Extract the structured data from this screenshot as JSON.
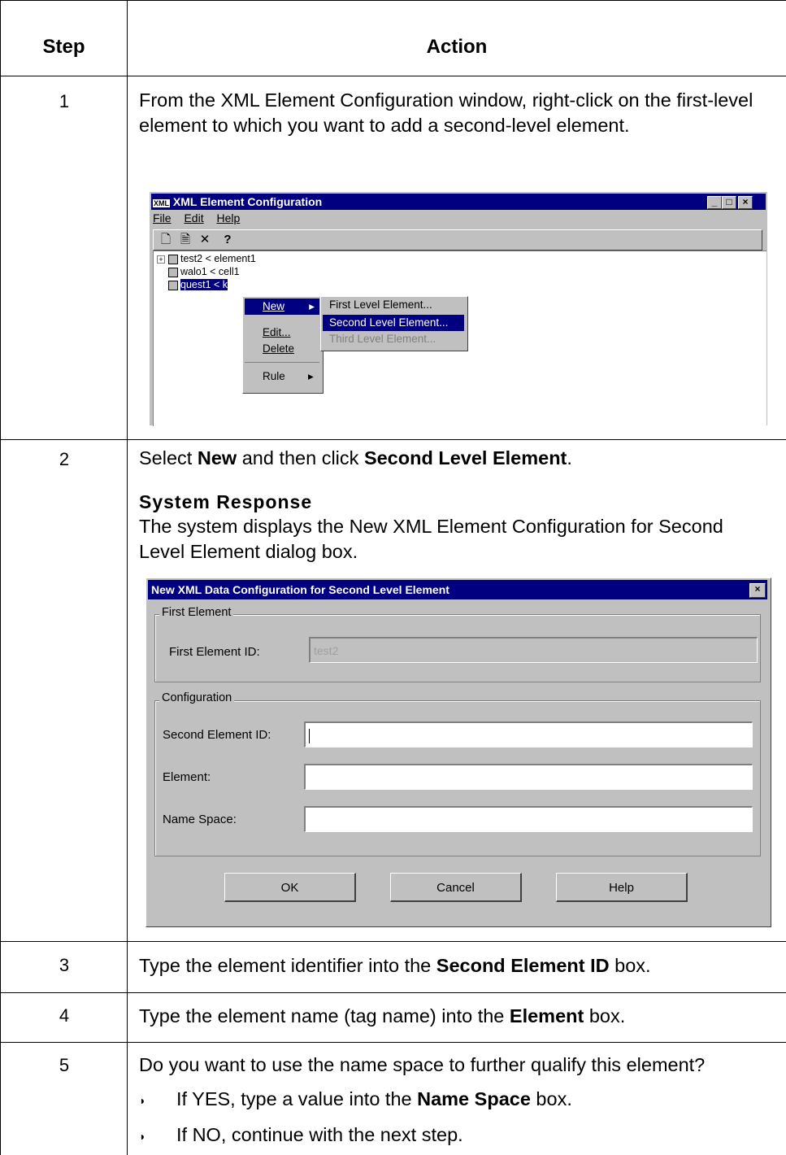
{
  "table": {
    "header_step": "Step",
    "header_action": "Action"
  },
  "steps": [
    {
      "num": "1",
      "text": "From the XML Element Configuration window, right-click on the first-level element to which you want to add a second-level element."
    },
    {
      "num": "2",
      "pre": "Select ",
      "b1": "New",
      "mid": " and then click ",
      "b2": "Second Level Element",
      "post": ".",
      "response_title": "System Response",
      "response_text": "The system displays the New XML Element Configuration for Second Level Element dialog box."
    },
    {
      "num": "3",
      "pre": "Type the element identifier into the ",
      "b1": "Second Element ID",
      "post": " box."
    },
    {
      "num": "4",
      "pre": "Type the element name (tag name) into the ",
      "b1": "Element",
      "post": " box."
    },
    {
      "num": "5",
      "text": "Do you want to use the name space to further qualify this element?",
      "bullet1_pre": "If YES, type a value into the ",
      "bullet1_b": "Name Space",
      "bullet1_post": " box.",
      "bullet2": "If NO, continue with the next step.",
      "bullet_mark": "◗"
    }
  ],
  "xml_window": {
    "title": "XML Element Configuration",
    "app_icon": "XML",
    "menu": [
      "File",
      "Edit",
      "Help"
    ],
    "toolbar_icons": [
      "new-icon",
      "properties-icon",
      "delete-icon",
      "help-icon"
    ],
    "tree": [
      "test2 < element1",
      "walo1 < cell1",
      "quest1 < k"
    ],
    "context_menu": [
      "New",
      "Edit...",
      "Delete",
      "Rule"
    ],
    "submenu": [
      "First Level Element...",
      "Second Level Element...",
      "Third Level Element..."
    ],
    "win_controls": [
      "_",
      "□",
      "×"
    ]
  },
  "dialog": {
    "title": "New XML Data Configuration for Second Level Element",
    "close": "×",
    "group1": "First Element",
    "first_id_label": "First Element ID:",
    "first_id_value": "test2",
    "group2": "Configuration",
    "second_id_label": "Second Element ID:",
    "element_label": "Element:",
    "namespace_label": "Name Space:",
    "ok": "OK",
    "cancel": "Cancel",
    "help": "Help"
  }
}
